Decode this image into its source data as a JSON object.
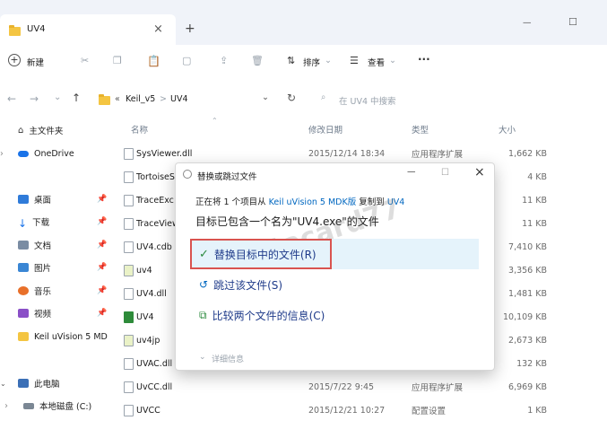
{
  "window": {
    "tab_title": "UV4",
    "minimize": "—",
    "maximize": "☐"
  },
  "toolbar": {
    "new_label": "新建",
    "sort_label": "排序",
    "view_label": "查看",
    "more_label": "···"
  },
  "address": {
    "path": [
      "«",
      "Keil_v5",
      ">",
      "UV4"
    ],
    "search_placeholder": "在 UV4 中搜索"
  },
  "sidebar": {
    "items": [
      {
        "label": "主文件夹",
        "icon": "home-icon"
      },
      {
        "label": "OneDrive",
        "icon": "cloud-icon"
      },
      {
        "label": "桌面",
        "icon": "desktop-icon"
      },
      {
        "label": "下载",
        "icon": "download-icon"
      },
      {
        "label": "文档",
        "icon": "document-icon"
      },
      {
        "label": "图片",
        "icon": "picture-icon"
      },
      {
        "label": "音乐",
        "icon": "music-icon"
      },
      {
        "label": "视频",
        "icon": "video-icon"
      },
      {
        "label": "Keil uVision 5 MD",
        "icon": "folder-icon"
      },
      {
        "label": "此电脑",
        "icon": "pc-icon"
      },
      {
        "label": "本地磁盘 (C:)",
        "icon": "drive-icon"
      }
    ]
  },
  "columns": {
    "name": "名称",
    "date": "修改日期",
    "type": "类型",
    "size": "大小"
  },
  "files": [
    {
      "name": "SysViewer.dll",
      "date": "2015/12/14 18:34",
      "type": "应用程序扩展",
      "size": "1,662 KB"
    },
    {
      "name": "TortoiseS",
      "date": "",
      "type": "",
      "size": "4 KB"
    },
    {
      "name": "TraceExc",
      "date": "",
      "type": "",
      "size": "11 KB"
    },
    {
      "name": "TraceView",
      "date": "",
      "type": "",
      "size": "11 KB"
    },
    {
      "name": "UV4.cdb",
      "date": "",
      "type": "",
      "size": "7,410 KB"
    },
    {
      "name": "uv4",
      "date": "",
      "type": "",
      "size": "3,356 KB"
    },
    {
      "name": "UV4.dll",
      "date": "",
      "type": "",
      "size": "1,481 KB"
    },
    {
      "name": "UV4",
      "date": "",
      "type": "",
      "size": "10,109 KB"
    },
    {
      "name": "uv4jp",
      "date": "",
      "type": "",
      "size": "2,673 KB"
    },
    {
      "name": "UVAC.dll",
      "date": "",
      "type": "",
      "size": "132 KB"
    },
    {
      "name": "UvCC.dll",
      "date": "2015/7/22 9:45",
      "type": "应用程序扩展",
      "size": "6,969 KB"
    },
    {
      "name": "UVCC",
      "date": "2015/12/21 10:27",
      "type": "配置设置",
      "size": "1 KB"
    }
  ],
  "dialog": {
    "title": "替换或跳过文件",
    "line1_prefix": "正在将 1 个项目从",
    "line1_source": "Keil uVision 5 MDK版",
    "line1_mid": "复制到",
    "line1_dest": "UV4",
    "message": "目标已包含一个名为\"UV4.exe\"的文件",
    "opt_replace": "替换目标中的文件(R)",
    "opt_skip": "跳过该文件(S)",
    "opt_compare": "比较两个文件的信息(C)",
    "details": "详细信息",
    "watermark": "datacard77"
  },
  "colors": {
    "accent": "#0067c0",
    "highlight": "#e5f3fb",
    "red_border": "#d9534f"
  }
}
